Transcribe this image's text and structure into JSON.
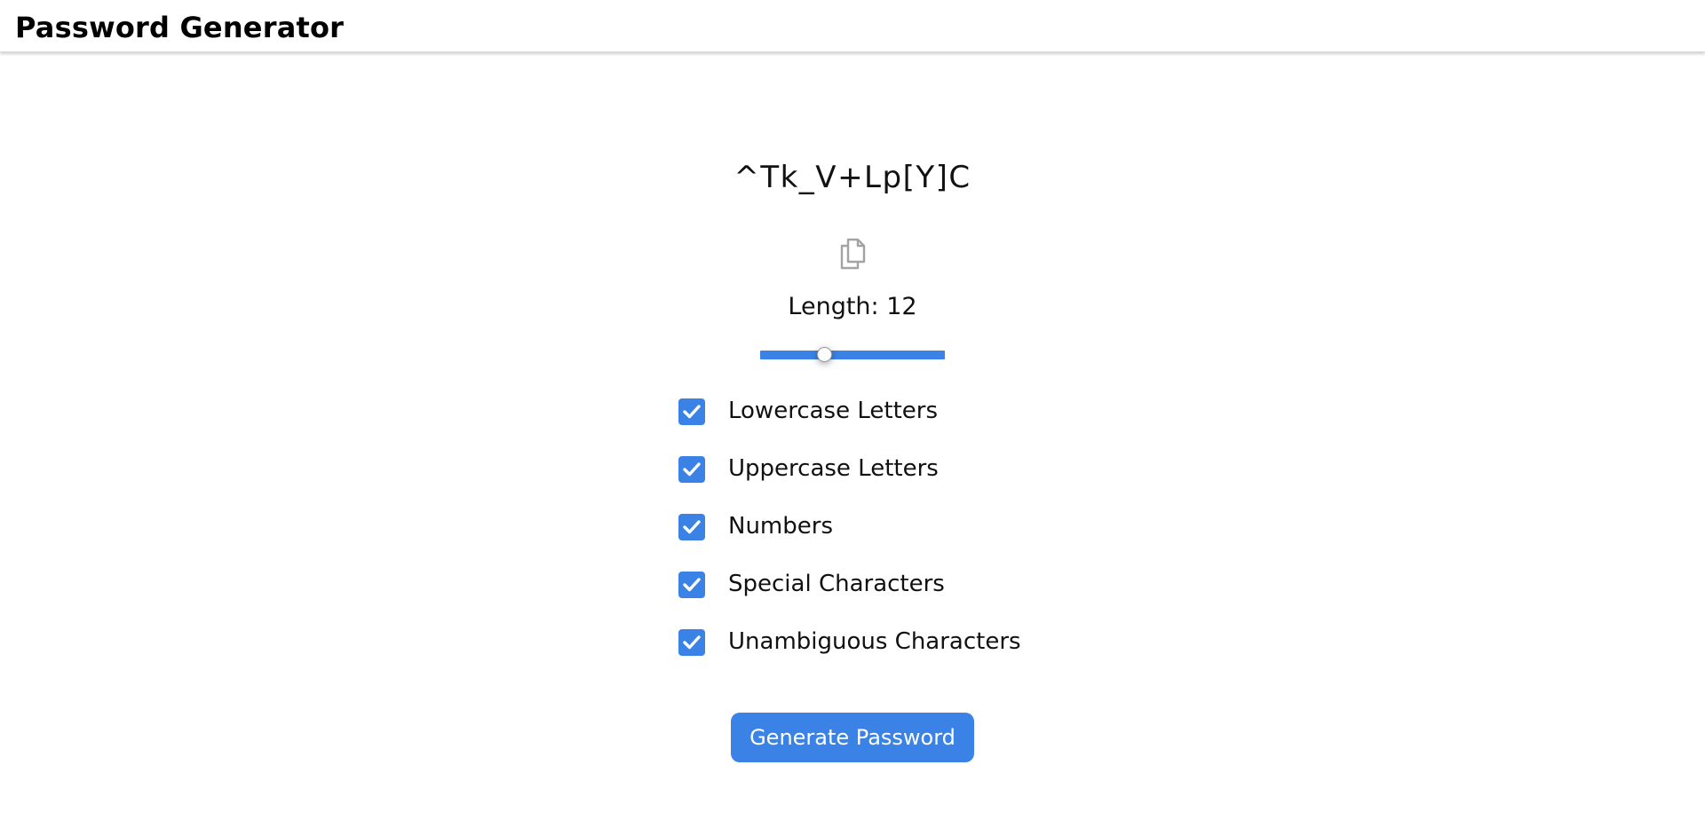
{
  "app": {
    "title": "Password Generator"
  },
  "password": {
    "value": "^Tk_V+Lp[Y]C",
    "copy_icon": "copy-icon"
  },
  "length": {
    "label": "Length: 12",
    "value": 12,
    "slider_fraction": 0.35
  },
  "options": [
    {
      "label": "Lowercase Letters",
      "checked": true
    },
    {
      "label": "Uppercase Letters",
      "checked": true
    },
    {
      "label": "Numbers",
      "checked": true
    },
    {
      "label": "Special Characters",
      "checked": true
    },
    {
      "label": "Unambiguous Characters",
      "checked": true
    }
  ],
  "generate_button": {
    "label": "Generate Password"
  },
  "colors": {
    "accent": "#3b82e6",
    "icon_gray": "#9e9e9e"
  }
}
